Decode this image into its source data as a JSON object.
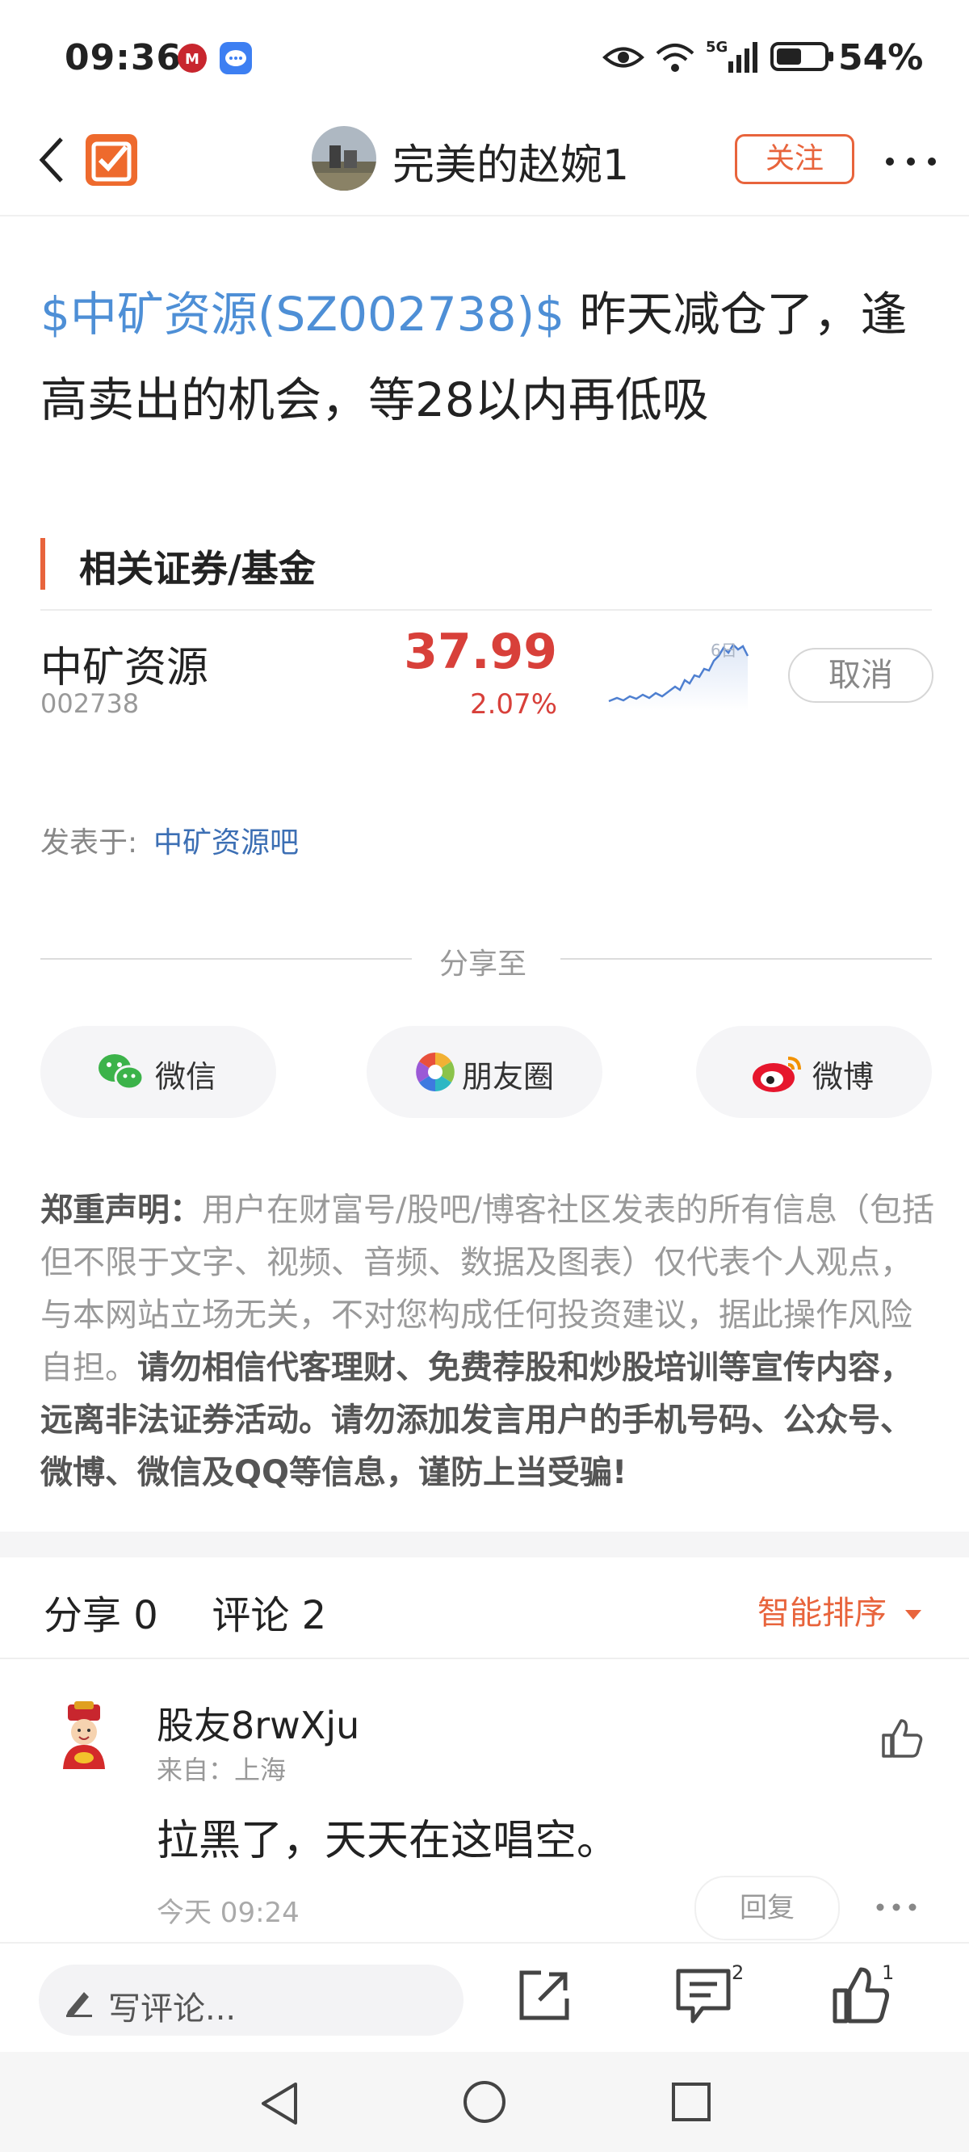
{
  "status_bar": {
    "time": "09:36",
    "network": "5G",
    "battery": "54%"
  },
  "nav": {
    "author": "完美的赵婉1",
    "follow_label": "关注"
  },
  "post": {
    "stock_tag": "$中矿资源(SZ002738)$",
    "line1_rest": " 昨天减仓了，逢",
    "line2": "高卖出的机会，等28以内再低吸"
  },
  "related": {
    "section_title": "相关证券/基金",
    "stock": {
      "name": "中矿资源",
      "code": "002738",
      "price": "37.99",
      "change": "2.07%",
      "chart_label": "6日",
      "cancel_label": "取消"
    }
  },
  "published": {
    "label": "发表于:",
    "forum": "中矿资源吧"
  },
  "share": {
    "label": "分享至",
    "targets": [
      {
        "label": "微信"
      },
      {
        "label": "朋友圈"
      },
      {
        "label": "微博"
      }
    ]
  },
  "disclaimer": {
    "title": "郑重声明：",
    "normal": "用户在财富号/股吧/博客社区发表的所有信息（包括但不限于文字、视频、音频、数据及图表）仅代表个人观点，与本网站立场无关，不对您构成任何投资建议，据此操作风险自担。",
    "bold": "请勿相信代客理财、免费荐股和炒股培训等宣传内容，远离非法证券活动。请勿添加发言用户的手机号码、公众号、微博、微信及QQ等信息，谨防上当受骗!"
  },
  "comments_header": {
    "share_label": "分享 0",
    "comment_label": "评论 2",
    "sort_label": "智能排序"
  },
  "comments": [
    {
      "user": "股友8rwXju",
      "from": "来自：上海",
      "text": "拉黑了，天天在这唱空。",
      "time": "今天 09:24",
      "reply_label": "回复"
    }
  ],
  "bottom_bar": {
    "placeholder": "写评论...",
    "comment_count": "2",
    "like_count": "1"
  },
  "colors": {
    "accent": "#e8643c",
    "link": "#4e8fd6",
    "price_up": "#d8403a"
  }
}
